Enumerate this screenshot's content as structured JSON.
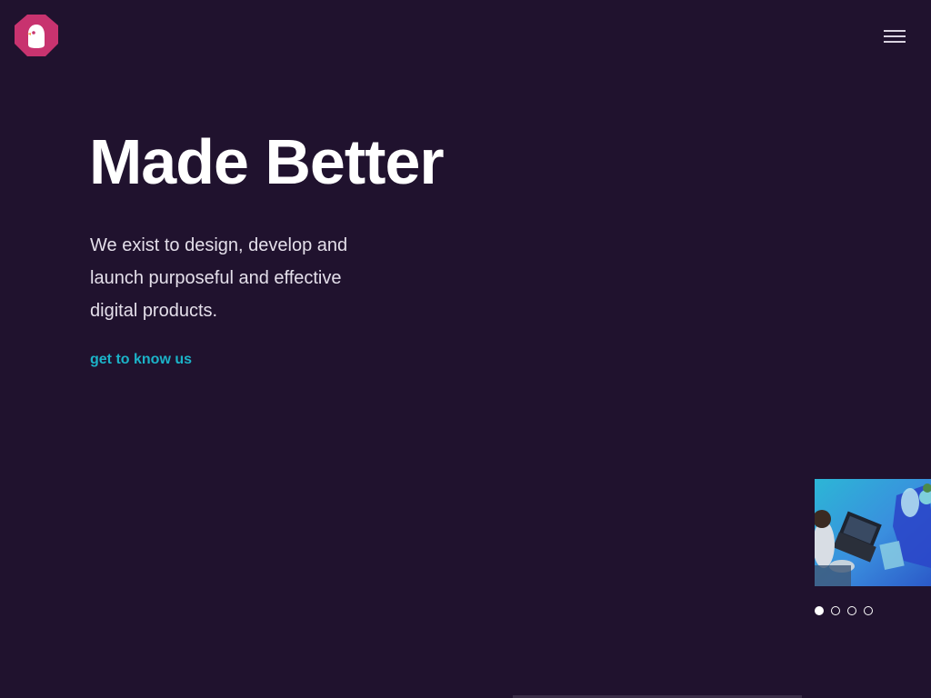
{
  "header": {
    "logo_icon": "chick-octagon-icon",
    "logo_color": "#c8336f",
    "menu_icon": "hamburger-menu-icon"
  },
  "hero": {
    "title": "Made Better",
    "description": "We exist to design, develop and launch purposeful and effective digital products.",
    "cta_label": "get to know us",
    "cta_color": "#1bb3c8"
  },
  "slider": {
    "image_icon": "team-laptop-photo",
    "dots": [
      {
        "active": true
      },
      {
        "active": false
      },
      {
        "active": false
      },
      {
        "active": false
      }
    ]
  },
  "colors": {
    "background": "#20122e",
    "text": "#ffffff",
    "accent": "#1bb3c8"
  }
}
